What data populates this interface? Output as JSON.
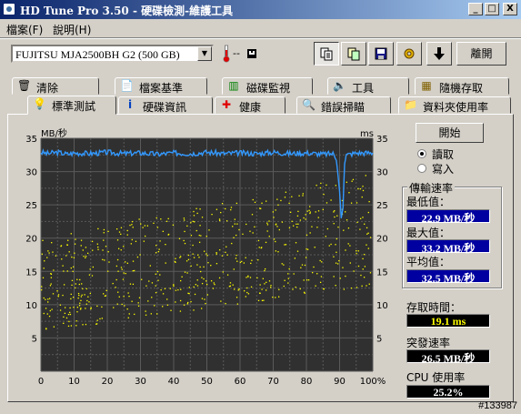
{
  "window": {
    "title": "HD Tune Pro 3.50 - 硬碟檢測-維護工具",
    "minimize": "_",
    "maximize": "□",
    "close": "X"
  },
  "menu": [
    "檔案(F)",
    "說明(H)"
  ],
  "toolbar": {
    "drive": "FUJITSU MJA2500BH G2 (500 GB)",
    "temperature": "--",
    "temp_unit_icon": "celsius-icon",
    "exit_label": "離開",
    "buttons": [
      "copy-text-icon",
      "copy-screenshot-icon",
      "save-icon",
      "options-icon",
      "download-icon"
    ]
  },
  "tabs_row1": [
    {
      "label": "清除",
      "icon": "trash-icon"
    },
    {
      "label": "檔案基準",
      "icon": "file-icon"
    },
    {
      "label": "磁碟監視",
      "icon": "monitor-icon"
    },
    {
      "label": "工具",
      "icon": "speaker-icon"
    },
    {
      "label": "隨機存取",
      "icon": "grid-icon"
    }
  ],
  "tabs_row2": [
    {
      "label": "標準測試",
      "icon": "bulb-icon",
      "active": true
    },
    {
      "label": "硬碟資訊",
      "icon": "info-icon"
    },
    {
      "label": "健康",
      "icon": "cross-icon"
    },
    {
      "label": "錯誤掃瞄",
      "icon": "magnifier-icon"
    },
    {
      "label": "資料夾使用率",
      "icon": "folder-icon"
    }
  ],
  "side": {
    "start_button": "開始",
    "read_label": "讀取",
    "write_label": "寫入",
    "mode_selected": "讀取",
    "transfer_group": "傳輸速率",
    "min_label": "最低值：",
    "min_value": "22.9 MB/秒",
    "max_label": "最大值：",
    "max_value": "33.2 MB/秒",
    "avg_label": "平均值：",
    "avg_value": "32.5 MB/秒",
    "access_label": "存取時間：",
    "access_value": "19.1 ms",
    "burst_label": "突發速率",
    "burst_value": "26.5 MB/秒",
    "cpu_label": "CPU 使用率",
    "cpu_value": "25.2%"
  },
  "chart_data": {
    "type": "line",
    "ylabel_left": "MB/秒",
    "ylabel_right": "ms",
    "y_ticks": [
      5,
      10,
      15,
      20,
      25,
      30,
      35
    ],
    "ylim": [
      0,
      35
    ],
    "right_ticks": [
      5,
      10,
      15,
      20,
      25,
      30,
      35
    ],
    "x_ticks": [
      "0",
      "10",
      "20",
      "30",
      "40",
      "50",
      "60",
      "70",
      "80",
      "90",
      "100%"
    ],
    "xlim": [
      0,
      100
    ],
    "series": [
      {
        "x": [
          0,
          2,
          5,
          8,
          10,
          15,
          20,
          25,
          30,
          35,
          40,
          45,
          50,
          55,
          60,
          65,
          70,
          75,
          80,
          85,
          88,
          89,
          90,
          90.5,
          91,
          91.5,
          92,
          93,
          95,
          100
        ],
        "values": [
          32.9,
          32.7,
          32.9,
          32.6,
          32.8,
          32.7,
          32.9,
          32.7,
          32.8,
          32.6,
          32.8,
          32.7,
          32.9,
          32.7,
          32.8,
          32.7,
          32.9,
          32.7,
          32.8,
          32.6,
          32.7,
          32.0,
          27.0,
          23.0,
          24.5,
          31.5,
          32.5,
          32.6,
          32.8,
          32.8
        ]
      }
    ],
    "access_scatter": {
      "x_range": [
        0,
        100
      ],
      "y_min_start": 6,
      "y_max_start": 20,
      "y_min_end": 13,
      "y_max_end": 30
    },
    "grid": true,
    "colors": {
      "background": "#303030",
      "grid": "#5a5a5a",
      "line": "#3399ff",
      "dots": "#ffff00"
    }
  },
  "status_text": "#133987"
}
